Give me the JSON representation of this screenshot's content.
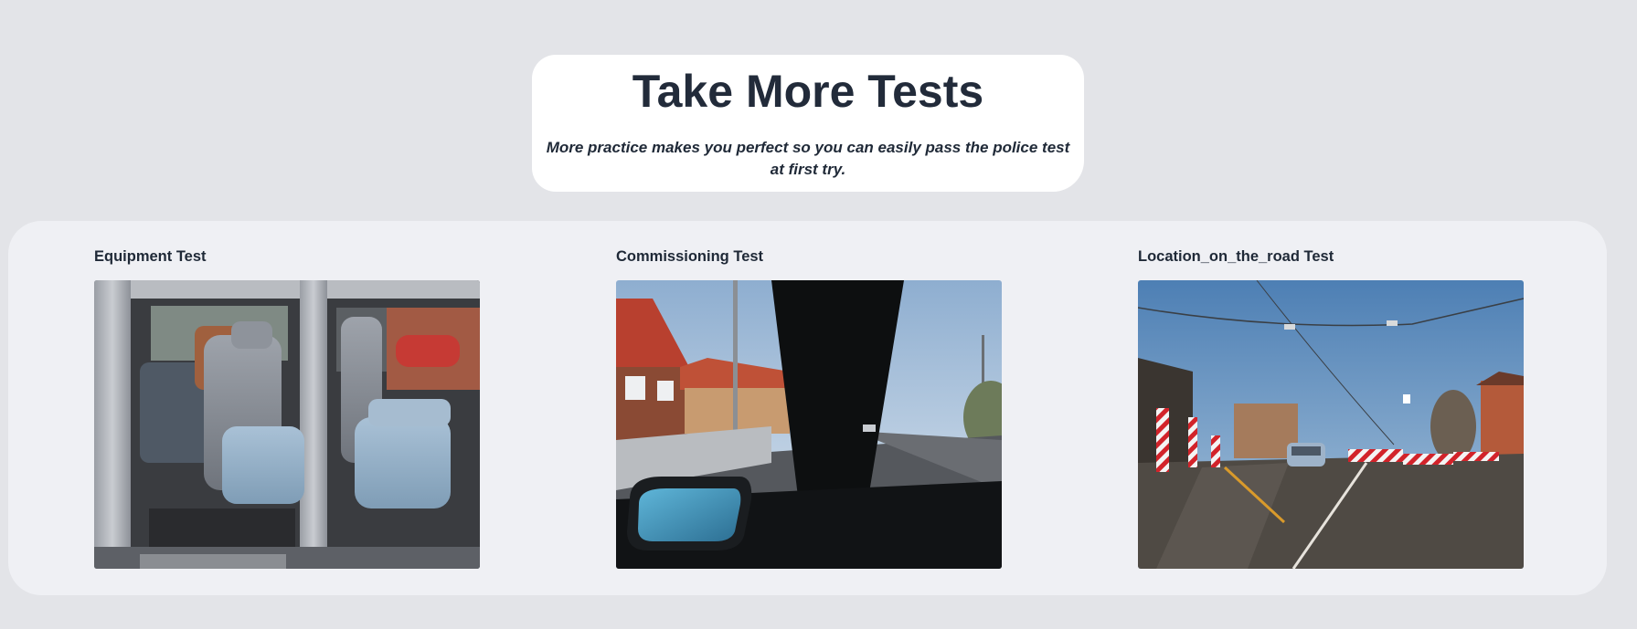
{
  "hero": {
    "title": "Take More Tests",
    "subtitle": "More practice makes you perfect so you can easily pass the police test at first try."
  },
  "tests": [
    {
      "title": "Equipment Test",
      "image": "van-interior-photo"
    },
    {
      "title": "Commissioning Test",
      "image": "road-from-car-photo"
    },
    {
      "title": "Location_on_the_road Test",
      "image": "roadworks-street-photo"
    }
  ],
  "colors": {
    "page_background": "#e3e4e8",
    "panel_background": "#eff0f4",
    "hero_background": "#ffffff",
    "text": "#1f2937"
  }
}
